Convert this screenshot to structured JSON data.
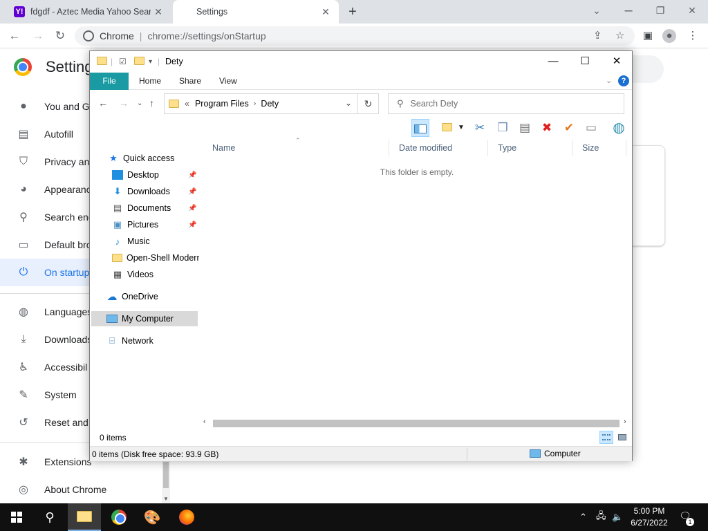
{
  "chrome": {
    "tabs": [
      {
        "title": "fdgdf - Aztec Media Yahoo Searc",
        "favicon": "Y!"
      },
      {
        "title": "Settings"
      }
    ],
    "new_tab": "+",
    "window_controls": {
      "minimize": "⌄",
      "restore": "❐",
      "close": "✕"
    },
    "omnibox": {
      "site_name": "Chrome",
      "separator": "|",
      "url": "chrome://settings/onStartup"
    }
  },
  "settings": {
    "title": "Settings",
    "nav_items": [
      {
        "label": "You and Go",
        "icon": "person-icon"
      },
      {
        "label": "Autofill",
        "icon": "clipboard-icon"
      },
      {
        "label": "Privacy an",
        "icon": "shield-icon"
      },
      {
        "label": "Appearanc",
        "icon": "palette-icon"
      },
      {
        "label": "Search eng",
        "icon": "search-icon"
      },
      {
        "label": "Default bro",
        "icon": "browser-icon"
      },
      {
        "label": "On startup",
        "icon": "power-icon",
        "active": true
      },
      {
        "label": "Languages",
        "icon": "globe-icon"
      },
      {
        "label": "Downloads",
        "icon": "download-icon"
      },
      {
        "label": "Accessibil",
        "icon": "accessibility-icon"
      },
      {
        "label": "System",
        "icon": "wrench-icon"
      },
      {
        "label": "Reset and",
        "icon": "reset-icon"
      },
      {
        "label": "Extensions",
        "icon": "puzzle-icon"
      },
      {
        "label": "About Chrome",
        "icon": "chrome-icon"
      }
    ]
  },
  "explorer": {
    "title": "Dety",
    "ribbon_tabs": [
      "File",
      "Home",
      "Share",
      "View"
    ],
    "help": "?",
    "address": {
      "prefix": "«",
      "crumbs": [
        "Program Files",
        "Dety"
      ]
    },
    "search_placeholder": "Search Dety",
    "nav_pane": {
      "quick_access": "Quick access",
      "pinned": [
        "Desktop",
        "Downloads",
        "Documents",
        "Pictures"
      ],
      "others": [
        "Music",
        "Open-Shell Modern",
        "Videos"
      ],
      "onedrive": "OneDrive",
      "my_computer": "My Computer",
      "network": "Network"
    },
    "columns": [
      "Name",
      "Date modified",
      "Type",
      "Size"
    ],
    "empty_message": "This folder is empty.",
    "item_count": "0 items",
    "details_status": "0 items (Disk free space: 93.9 GB)",
    "details_location": "Computer"
  },
  "taskbar": {
    "time": "5:00 PM",
    "date": "6/27/2022",
    "notification_count": "1"
  },
  "colors": {
    "ribbon_file_tab": "#1a9ba3",
    "settings_active": "#1a73e8",
    "taskbar": "#101010"
  }
}
